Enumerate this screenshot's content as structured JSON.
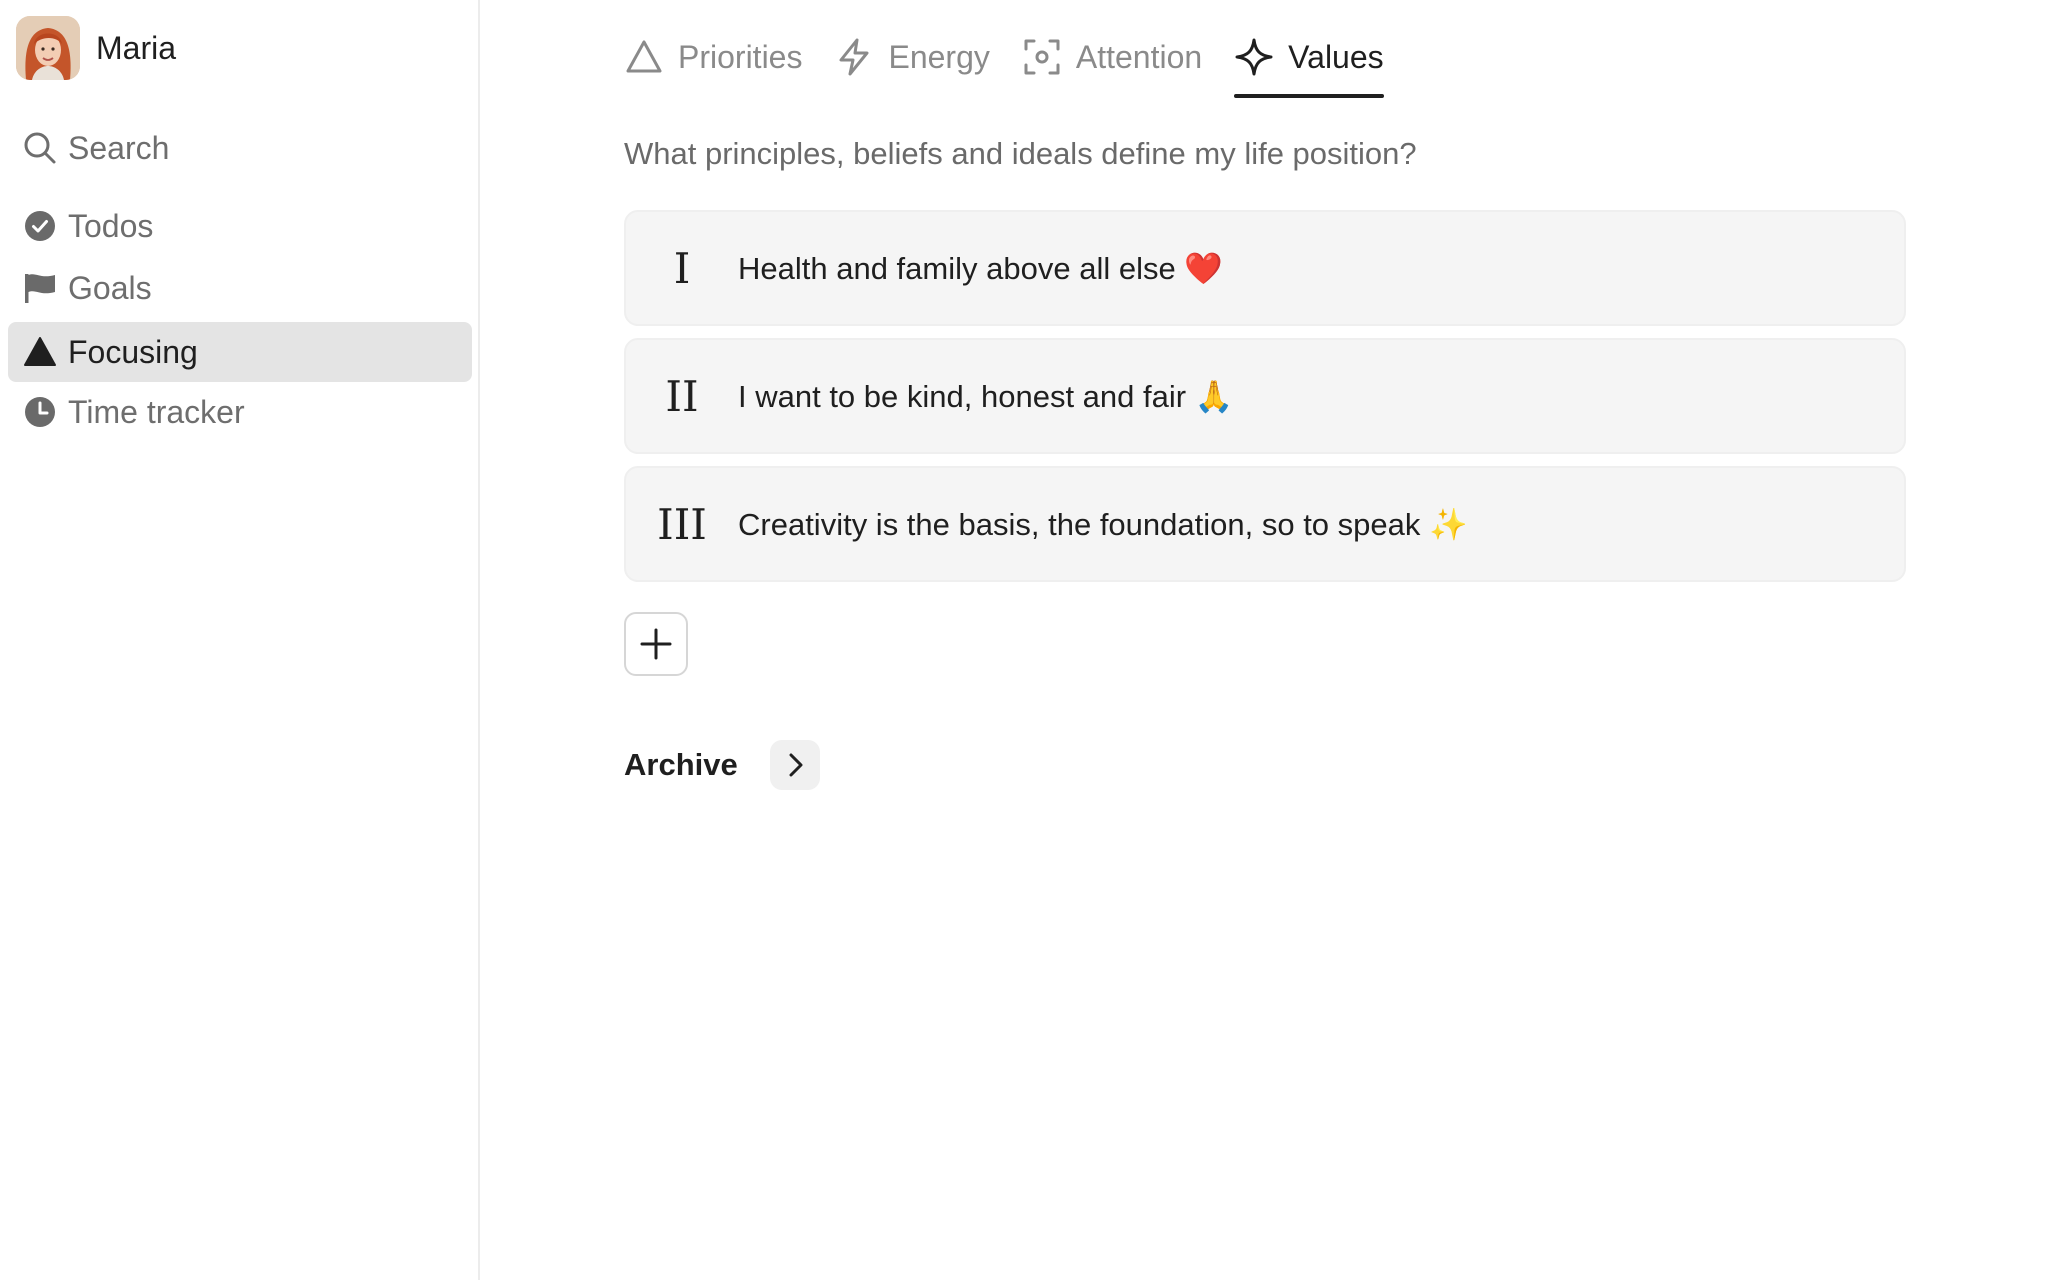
{
  "user": {
    "name": "Maria"
  },
  "sidebar": {
    "items": [
      {
        "label": "Search",
        "icon": "search-icon"
      },
      {
        "label": "Todos",
        "icon": "check-circle-icon"
      },
      {
        "label": "Goals",
        "icon": "flag-icon"
      },
      {
        "label": "Focusing",
        "icon": "triangle-icon",
        "active": true
      },
      {
        "label": "Time tracker",
        "icon": "clock-icon"
      }
    ]
  },
  "tabs": [
    {
      "label": "Priorities",
      "icon": "triangle-outline-icon"
    },
    {
      "label": "Energy",
      "icon": "lightning-icon"
    },
    {
      "label": "Attention",
      "icon": "focus-target-icon"
    },
    {
      "label": "Values",
      "icon": "sparkle-icon",
      "active": true
    }
  ],
  "main": {
    "question": "What principles, beliefs and ideals define my life position?",
    "values": [
      {
        "numeral": "I",
        "text": "Health and family above all else ❤️"
      },
      {
        "numeral": "II",
        "text": "I want to be kind, honest and fair 🙏"
      },
      {
        "numeral": "III",
        "text": "Creativity is the basis, the foundation, so to speak ✨"
      }
    ],
    "archive_label": "Archive"
  },
  "colors": {
    "active_bg": "#e4e4e4",
    "card_bg": "#f5f5f5",
    "text_primary": "#1f1f1f",
    "text_muted": "#6e6e6e"
  }
}
